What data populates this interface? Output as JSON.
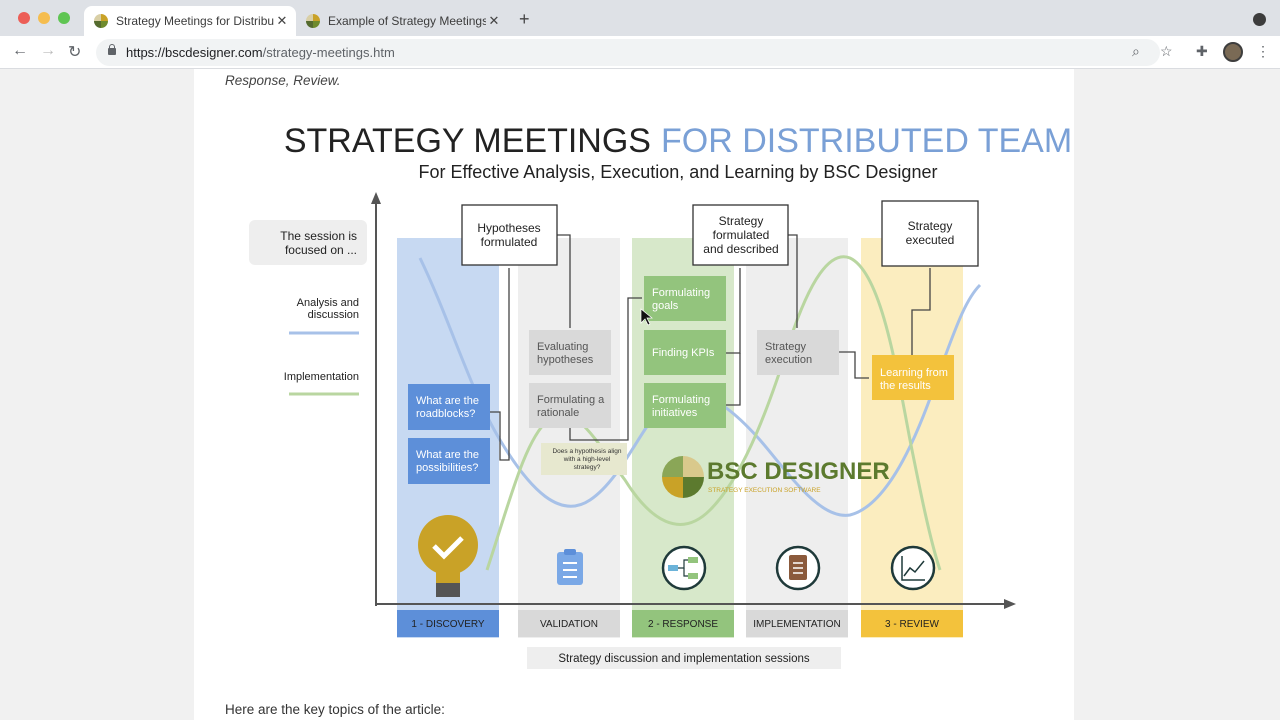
{
  "browser": {
    "tabs": [
      {
        "title": "Strategy Meetings for Distribut",
        "active": true
      },
      {
        "title": "Example of Strategy Meetings",
        "active": false
      }
    ],
    "url_host": "https://bscdesigner.com",
    "url_path": "/strategy-meetings.htm"
  },
  "article": {
    "lead_text": "Response, Review.",
    "footer_text": "Here are the key topics of the article:"
  },
  "infographic": {
    "title_part1": "STRATEGY MEETINGS",
    "title_part2": "FOR DISTRIBUTED TEAM",
    "subtitle": "For Effective Analysis, Execution, and Learning by BSC Designer",
    "legend": {
      "focus_line1": "The session is",
      "focus_line2": "focused on ...",
      "analysis_line1": "Analysis and",
      "analysis_line2": "discussion",
      "implementation": "Implementation"
    },
    "stages": [
      "1 - DISCOVERY",
      "VALIDATION",
      "2 - RESPONSE",
      "IMPLEMENTATION",
      "3 - REVIEW"
    ],
    "boxes": {
      "hyp_1": "Hypotheses",
      "hyp_2": "formulated",
      "form_1": "Strategy",
      "form_2": "formulated",
      "form_3": "and described",
      "exec_1": "Strategy",
      "exec_2": "executed"
    },
    "cards": {
      "roadblocks_1": "What are the",
      "roadblocks_2": "roadblocks?",
      "possibilities_1": "What are the",
      "possibilities_2": "possibilities?",
      "evaluating_1": "Evaluating",
      "evaluating_2": "hypotheses",
      "rationale_1": "Formulating a",
      "rationale_2": "rationale",
      "align_1": "Does a hypothesis align",
      "align_2": "with a high-level",
      "align_3": "strategy?",
      "goals_1": "Formulating",
      "goals_2": "goals",
      "kpis": "Finding KPIs",
      "initiatives_1": "Formulating",
      "initiatives_2": "initiatives",
      "execution_1": "Strategy",
      "execution_2": "execution",
      "learning_1": "Learning from",
      "learning_2": "the results"
    },
    "logo": {
      "name": "BSC DESIGNER",
      "tagline": "STRATEGY EXECUTION SOFTWARE"
    },
    "sessions_label": "Strategy discussion and implementation sessions",
    "colors": {
      "blue_line": "#a7c1e8",
      "green_line": "#b9d6a0",
      "accent_blue": "#6f9bd8"
    }
  }
}
